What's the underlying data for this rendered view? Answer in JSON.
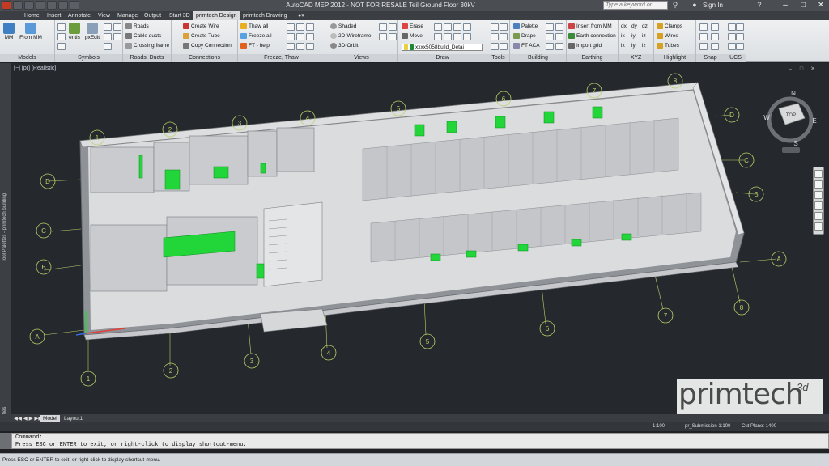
{
  "titlebar": {
    "title": "AutoCAD MEP 2012 - NOT FOR RESALE    Teil Ground Floor 30kV",
    "search_placeholder": "Type a keyword or phrase",
    "signin": "Sign In"
  },
  "menu": {
    "tabs": [
      "Home",
      "Insert",
      "Annotate",
      "View",
      "Manage",
      "Output",
      "Start 3D",
      "primtech Design",
      "primtech Drawing"
    ],
    "active_tab": "primtech Design"
  },
  "ribbon": {
    "panels": {
      "models": "Models",
      "symbols": "Symbols",
      "roads": "Roads, Ducts",
      "connections": "Connections",
      "freeze": "Freeze, Thaw",
      "views": "Views",
      "draw": "Draw",
      "tools": "Tools",
      "building": "Building",
      "earthing": "Earthing",
      "xyz": "XYZ",
      "highlight": "Highlight",
      "snap": "Snap",
      "ucs": "UCS"
    },
    "models": {
      "mm": "MM",
      "from_mm": "From MM"
    },
    "symbols": {
      "entis": "entis",
      "pxedit": "pxEdit"
    },
    "roads": {
      "roads": "Roads",
      "cable_ducts": "Cable ducts",
      "crossing_frame": "Crossing frame"
    },
    "connections": {
      "create_wire": "Create Wire",
      "create_tube": "Create Tube",
      "copy_connection": "Copy Connection"
    },
    "freeze": {
      "thaw_all": "Thaw all",
      "freeze_all": "Freeze all",
      "ft_help": "FT - help"
    },
    "views": {
      "shaded": "Shaded",
      "wireframe": "2D-Wireframe",
      "orbit": "3D-Orbit"
    },
    "draw": {
      "erase": "Erase",
      "move": "Move",
      "layer": "xxxx5058build_Detai"
    },
    "building": {
      "palette": "Palette",
      "drape": "Drape",
      "ft_aca": "FT ACA"
    },
    "earthing": {
      "insert_from_mm": "Insert from MM",
      "earth_connection": "Earth connection",
      "import_grid": "Import grid"
    },
    "xyz": {
      "dx": "dx",
      "dy": "dy",
      "dz": "dz",
      "ix": "ix",
      "iy": "iy",
      "iz": "iz",
      "lx": "lx",
      "ly": "ly",
      "lz": "lz"
    },
    "highlight": {
      "clamps": "Clamps",
      "wires": "Wires",
      "tubes": "Tubes"
    }
  },
  "viewport": {
    "label": "[−] [pr] [Realistic]",
    "left_palette_top": "Tool Palettes - primtech building",
    "left_palette_bottom": "Properties"
  },
  "viewcube": {
    "face": "TOP",
    "n": "N",
    "s": "S",
    "e": "E",
    "w": "W"
  },
  "grid_labels": {
    "left": [
      "D",
      "C",
      "B",
      "A"
    ],
    "bottom": [
      "1",
      "2",
      "3",
      "4",
      "5",
      "6",
      "7",
      "8"
    ],
    "right": [
      "D",
      "C",
      "B",
      "A"
    ],
    "top": [
      "1",
      "2",
      "3",
      "4",
      "5",
      "6",
      "7",
      "8"
    ]
  },
  "layout_tabs": {
    "model": "Model",
    "layout1": "Layout1"
  },
  "statusbar": {
    "scale": "1:100",
    "annotation": "pr_Submission 1:100",
    "cut_plane": "Cut Plane:  1400"
  },
  "command": {
    "label": "Command:",
    "prompt": "Press ESC or ENTER to exit, or right-click to display shortcut-menu."
  },
  "appstatus": "Press ESC or ENTER to exit, or right-click to display shortcut-menu.",
  "watermark": {
    "text": "primtech",
    "sup": "3d"
  },
  "colors": {
    "accent_green": "#22d63a",
    "building": "#d0d2d4",
    "grid_line": "#b8d36a",
    "background": "#25282c"
  }
}
